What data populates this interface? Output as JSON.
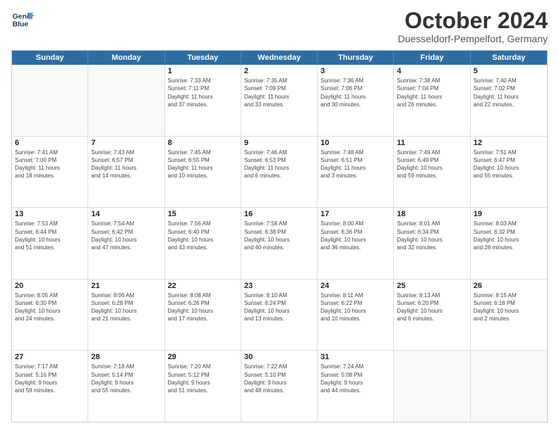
{
  "header": {
    "logo_line1": "General",
    "logo_line2": "Blue",
    "month_title": "October 2024",
    "subtitle": "Duesseldorf-Pempelfort, Germany"
  },
  "day_headers": [
    "Sunday",
    "Monday",
    "Tuesday",
    "Wednesday",
    "Thursday",
    "Friday",
    "Saturday"
  ],
  "weeks": [
    [
      {
        "num": "",
        "info": ""
      },
      {
        "num": "",
        "info": ""
      },
      {
        "num": "1",
        "info": "Sunrise: 7:33 AM\nSunset: 7:11 PM\nDaylight: 11 hours\nand 37 minutes."
      },
      {
        "num": "2",
        "info": "Sunrise: 7:35 AM\nSunset: 7:09 PM\nDaylight: 11 hours\nand 33 minutes."
      },
      {
        "num": "3",
        "info": "Sunrise: 7:36 AM\nSunset: 7:06 PM\nDaylight: 11 hours\nand 30 minutes."
      },
      {
        "num": "4",
        "info": "Sunrise: 7:38 AM\nSunset: 7:04 PM\nDaylight: 11 hours\nand 26 minutes."
      },
      {
        "num": "5",
        "info": "Sunrise: 7:40 AM\nSunset: 7:02 PM\nDaylight: 11 hours\nand 22 minutes."
      }
    ],
    [
      {
        "num": "6",
        "info": "Sunrise: 7:41 AM\nSunset: 7:00 PM\nDaylight: 11 hours\nand 18 minutes."
      },
      {
        "num": "7",
        "info": "Sunrise: 7:43 AM\nSunset: 6:57 PM\nDaylight: 11 hours\nand 14 minutes."
      },
      {
        "num": "8",
        "info": "Sunrise: 7:45 AM\nSunset: 6:55 PM\nDaylight: 11 hours\nand 10 minutes."
      },
      {
        "num": "9",
        "info": "Sunrise: 7:46 AM\nSunset: 6:53 PM\nDaylight: 11 hours\nand 6 minutes."
      },
      {
        "num": "10",
        "info": "Sunrise: 7:48 AM\nSunset: 6:51 PM\nDaylight: 11 hours\nand 3 minutes."
      },
      {
        "num": "11",
        "info": "Sunrise: 7:49 AM\nSunset: 6:49 PM\nDaylight: 10 hours\nand 59 minutes."
      },
      {
        "num": "12",
        "info": "Sunrise: 7:51 AM\nSunset: 6:47 PM\nDaylight: 10 hours\nand 55 minutes."
      }
    ],
    [
      {
        "num": "13",
        "info": "Sunrise: 7:53 AM\nSunset: 6:44 PM\nDaylight: 10 hours\nand 51 minutes."
      },
      {
        "num": "14",
        "info": "Sunrise: 7:54 AM\nSunset: 6:42 PM\nDaylight: 10 hours\nand 47 minutes."
      },
      {
        "num": "15",
        "info": "Sunrise: 7:56 AM\nSunset: 6:40 PM\nDaylight: 10 hours\nand 43 minutes."
      },
      {
        "num": "16",
        "info": "Sunrise: 7:58 AM\nSunset: 6:38 PM\nDaylight: 10 hours\nand 40 minutes."
      },
      {
        "num": "17",
        "info": "Sunrise: 8:00 AM\nSunset: 6:36 PM\nDaylight: 10 hours\nand 36 minutes."
      },
      {
        "num": "18",
        "info": "Sunrise: 8:01 AM\nSunset: 6:34 PM\nDaylight: 10 hours\nand 32 minutes."
      },
      {
        "num": "19",
        "info": "Sunrise: 8:03 AM\nSunset: 6:32 PM\nDaylight: 10 hours\nand 28 minutes."
      }
    ],
    [
      {
        "num": "20",
        "info": "Sunrise: 8:05 AM\nSunset: 6:30 PM\nDaylight: 10 hours\nand 24 minutes."
      },
      {
        "num": "21",
        "info": "Sunrise: 8:06 AM\nSunset: 6:28 PM\nDaylight: 10 hours\nand 21 minutes."
      },
      {
        "num": "22",
        "info": "Sunrise: 8:08 AM\nSunset: 6:26 PM\nDaylight: 10 hours\nand 17 minutes."
      },
      {
        "num": "23",
        "info": "Sunrise: 8:10 AM\nSunset: 6:24 PM\nDaylight: 10 hours\nand 13 minutes."
      },
      {
        "num": "24",
        "info": "Sunrise: 8:11 AM\nSunset: 6:22 PM\nDaylight: 10 hours\nand 10 minutes."
      },
      {
        "num": "25",
        "info": "Sunrise: 8:13 AM\nSunset: 6:20 PM\nDaylight: 10 hours\nand 6 minutes."
      },
      {
        "num": "26",
        "info": "Sunrise: 8:15 AM\nSunset: 6:18 PM\nDaylight: 10 hours\nand 2 minutes."
      }
    ],
    [
      {
        "num": "27",
        "info": "Sunrise: 7:17 AM\nSunset: 5:16 PM\nDaylight: 9 hours\nand 59 minutes."
      },
      {
        "num": "28",
        "info": "Sunrise: 7:18 AM\nSunset: 5:14 PM\nDaylight: 9 hours\nand 55 minutes."
      },
      {
        "num": "29",
        "info": "Sunrise: 7:20 AM\nSunset: 5:12 PM\nDaylight: 9 hours\nand 51 minutes."
      },
      {
        "num": "30",
        "info": "Sunrise: 7:22 AM\nSunset: 5:10 PM\nDaylight: 9 hours\nand 48 minutes."
      },
      {
        "num": "31",
        "info": "Sunrise: 7:24 AM\nSunset: 5:08 PM\nDaylight: 9 hours\nand 44 minutes."
      },
      {
        "num": "",
        "info": ""
      },
      {
        "num": "",
        "info": ""
      }
    ]
  ]
}
